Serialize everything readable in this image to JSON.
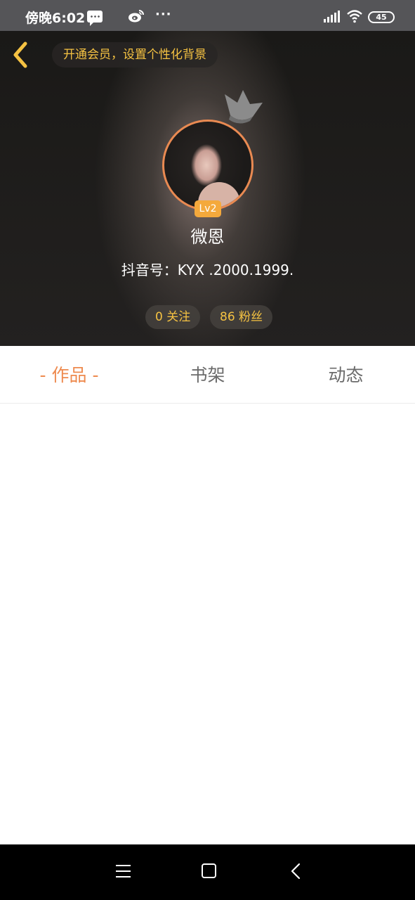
{
  "status_bar": {
    "time": "傍晚6:02",
    "more": "···",
    "battery": "45",
    "icons": [
      "message-icon",
      "weibo-icon",
      "more-icon",
      "signal-icon",
      "wifi-icon",
      "battery-icon"
    ]
  },
  "header": {
    "back_icon": "chevron-left-icon",
    "vip_banner": "开通会员，设置个性化背景",
    "level": "Lv2",
    "name": "微恩",
    "douyin_id": "抖音号：KYX .2000.1999.",
    "following": "0 关注",
    "followers": "86 粉丝",
    "colors": {
      "accent": "#f5c242",
      "badge": "#f4a93c",
      "avatar_ring": "#e98a52"
    }
  },
  "tabs": [
    {
      "label": "- 作品 -",
      "active": true
    },
    {
      "label": "书架",
      "active": false
    },
    {
      "label": "动态",
      "active": false
    }
  ],
  "tab_colors": {
    "active": "#ee8a4e",
    "inactive": "#6b6b6b"
  },
  "nav_bar": {
    "icons": [
      "menu-icon",
      "home-icon",
      "back-icon"
    ]
  }
}
